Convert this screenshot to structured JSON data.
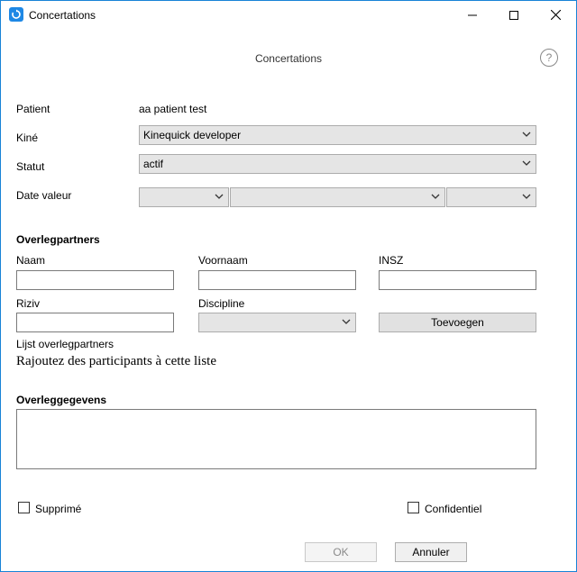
{
  "window": {
    "title": "Concertations",
    "icon": "app-sync-icon",
    "controls": [
      "minimize-icon",
      "maximize-icon",
      "close-icon"
    ]
  },
  "header": {
    "title": "Concertations",
    "help_symbol": "?"
  },
  "form": {
    "patient_label": "Patient",
    "patient_value": "aa patient test",
    "kine_label": "Kiné",
    "kine_value": "Kinequick developer",
    "statut_label": "Statut",
    "statut_value": "actif",
    "date_label": "Date valeur",
    "date_day": "",
    "date_month": "",
    "date_year": ""
  },
  "partners": {
    "section_title": "Overlegpartners",
    "naam_label": "Naam",
    "naam_value": "",
    "voornaam_label": "Voornaam",
    "voornaam_value": "",
    "insz_label": "INSZ",
    "insz_value": "",
    "riziv_label": "Riziv",
    "riziv_value": "",
    "discipline_label": "Discipline",
    "discipline_value": "",
    "add_button": "Toevoegen",
    "list_label": "Lijst overlegpartners",
    "list_placeholder": "Rajoutez des participants à cette liste"
  },
  "details": {
    "section_title": "Overleggegevens",
    "value": ""
  },
  "options": {
    "deleted_label": "Supprimé",
    "deleted_checked": false,
    "confidential_label": "Confidentiel",
    "confidential_checked": false
  },
  "footer": {
    "ok_label": "OK",
    "cancel_label": "Annuler"
  },
  "colors": {
    "window_border": "#1883d7",
    "app_icon": "#1e88e5",
    "select_bg": "#e5e5e5",
    "button_bg": "#e1e1e1"
  }
}
